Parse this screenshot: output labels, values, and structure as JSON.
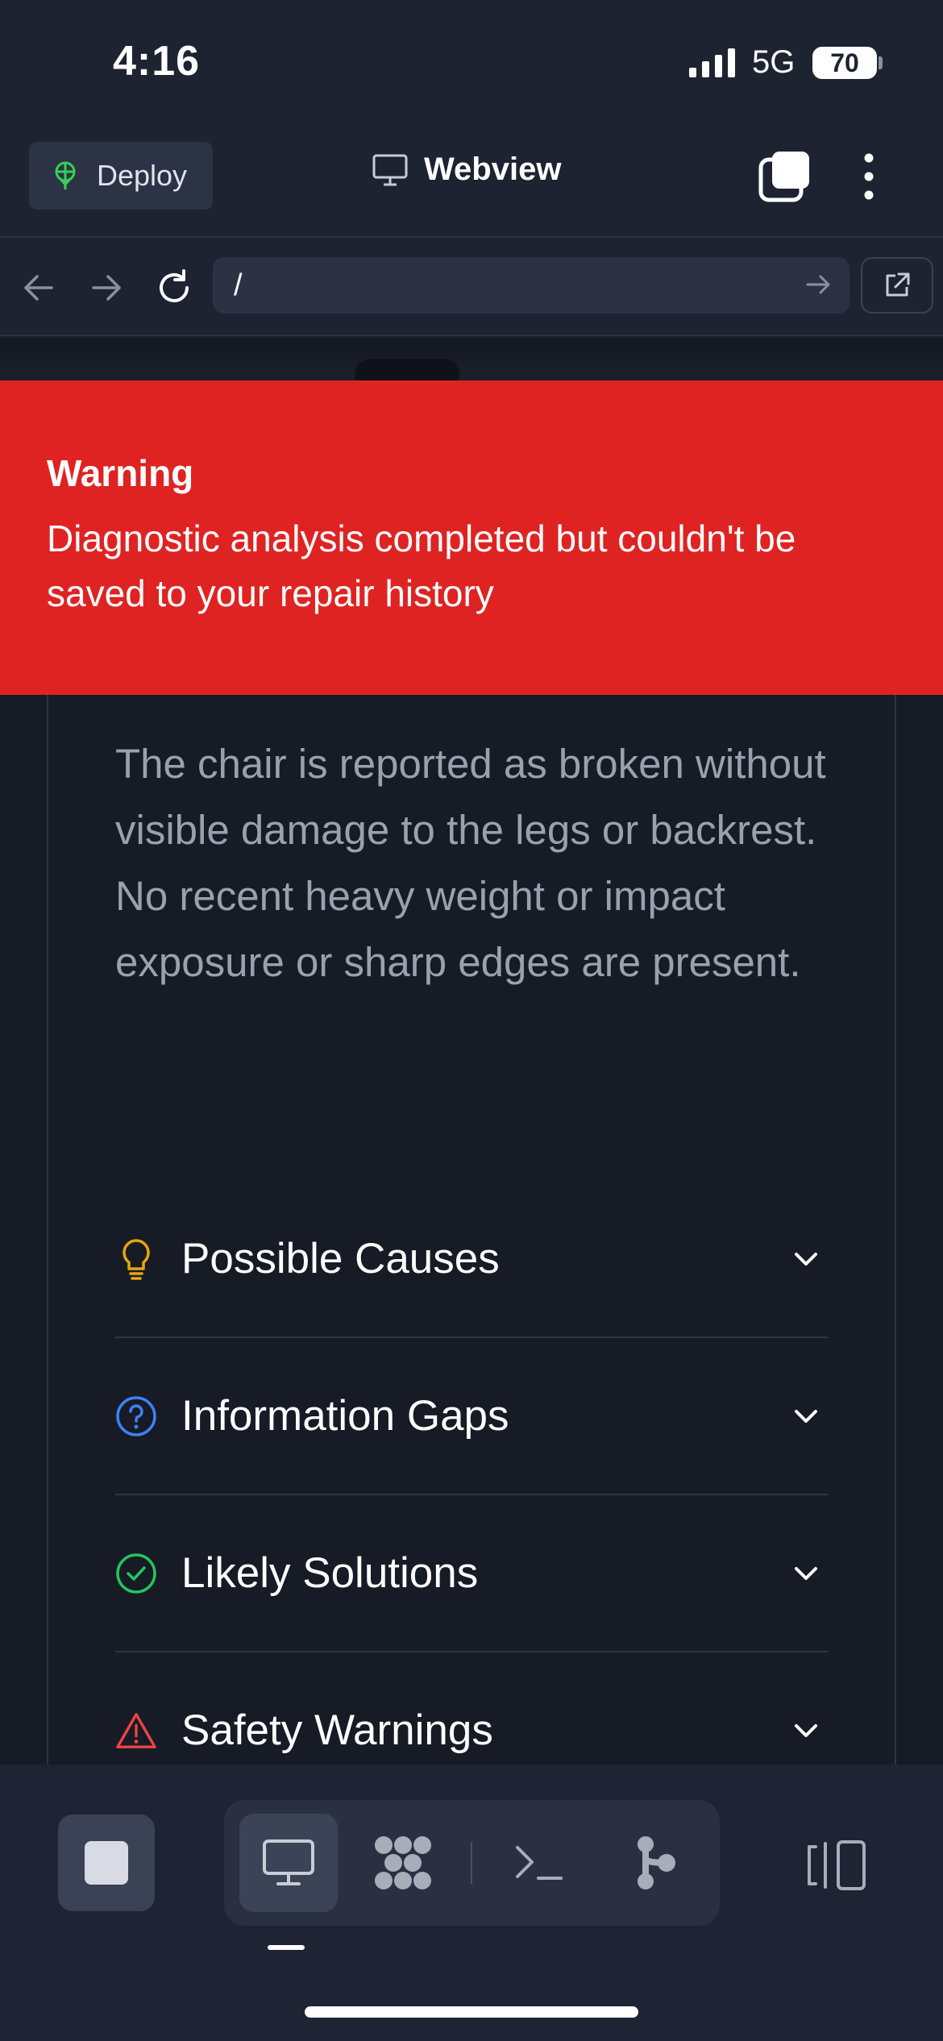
{
  "status_bar": {
    "time": "4:16",
    "network": "5G",
    "battery": "70"
  },
  "header": {
    "deploy_label": "Deploy",
    "title": "Webview"
  },
  "url_bar": {
    "url": "/"
  },
  "warning": {
    "title": "Warning",
    "message": "Diagnostic analysis completed but couldn't be saved to your repair history"
  },
  "content": {
    "summary": "The chair is reported as broken without visible damage to the legs or backrest. No recent heavy weight or impact exposure or sharp edges are present.",
    "sections": [
      {
        "label": "Possible Causes",
        "icon": "lightbulb-icon",
        "color": "#e8a50f"
      },
      {
        "label": "Information Gaps",
        "icon": "question-circle-icon",
        "color": "#3b82f6"
      },
      {
        "label": "Likely Solutions",
        "icon": "check-circle-icon",
        "color": "#22c55e"
      },
      {
        "label": "Safety Warnings",
        "icon": "alert-triangle-icon",
        "color": "#ef4444"
      }
    ]
  },
  "colors": {
    "warning_bg": "#df2323",
    "background": "#171b26",
    "accent": "#3b82f6"
  }
}
